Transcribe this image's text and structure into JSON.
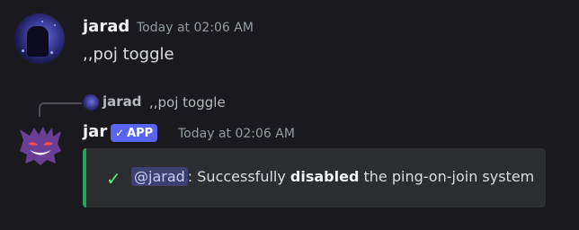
{
  "message1": {
    "author": "jarad",
    "timestamp": "Today at 02:06 AM",
    "content": ",,poj toggle"
  },
  "reply": {
    "author": "jarad",
    "content": ",,poj toggle"
  },
  "message2": {
    "author": "jar",
    "badge": "APP",
    "timestamp": "Today at 02:06 AM",
    "embed": {
      "icon": "check-icon",
      "mention": "@jarad",
      "text_before": ": Successfully ",
      "bold": "disabled",
      "text_after": " the ping-on-join system",
      "accent_color": "#23a55a"
    }
  },
  "colors": {
    "background": "#1a1a1e",
    "badge": "#5865f2",
    "embed_background": "#2b2d31"
  }
}
